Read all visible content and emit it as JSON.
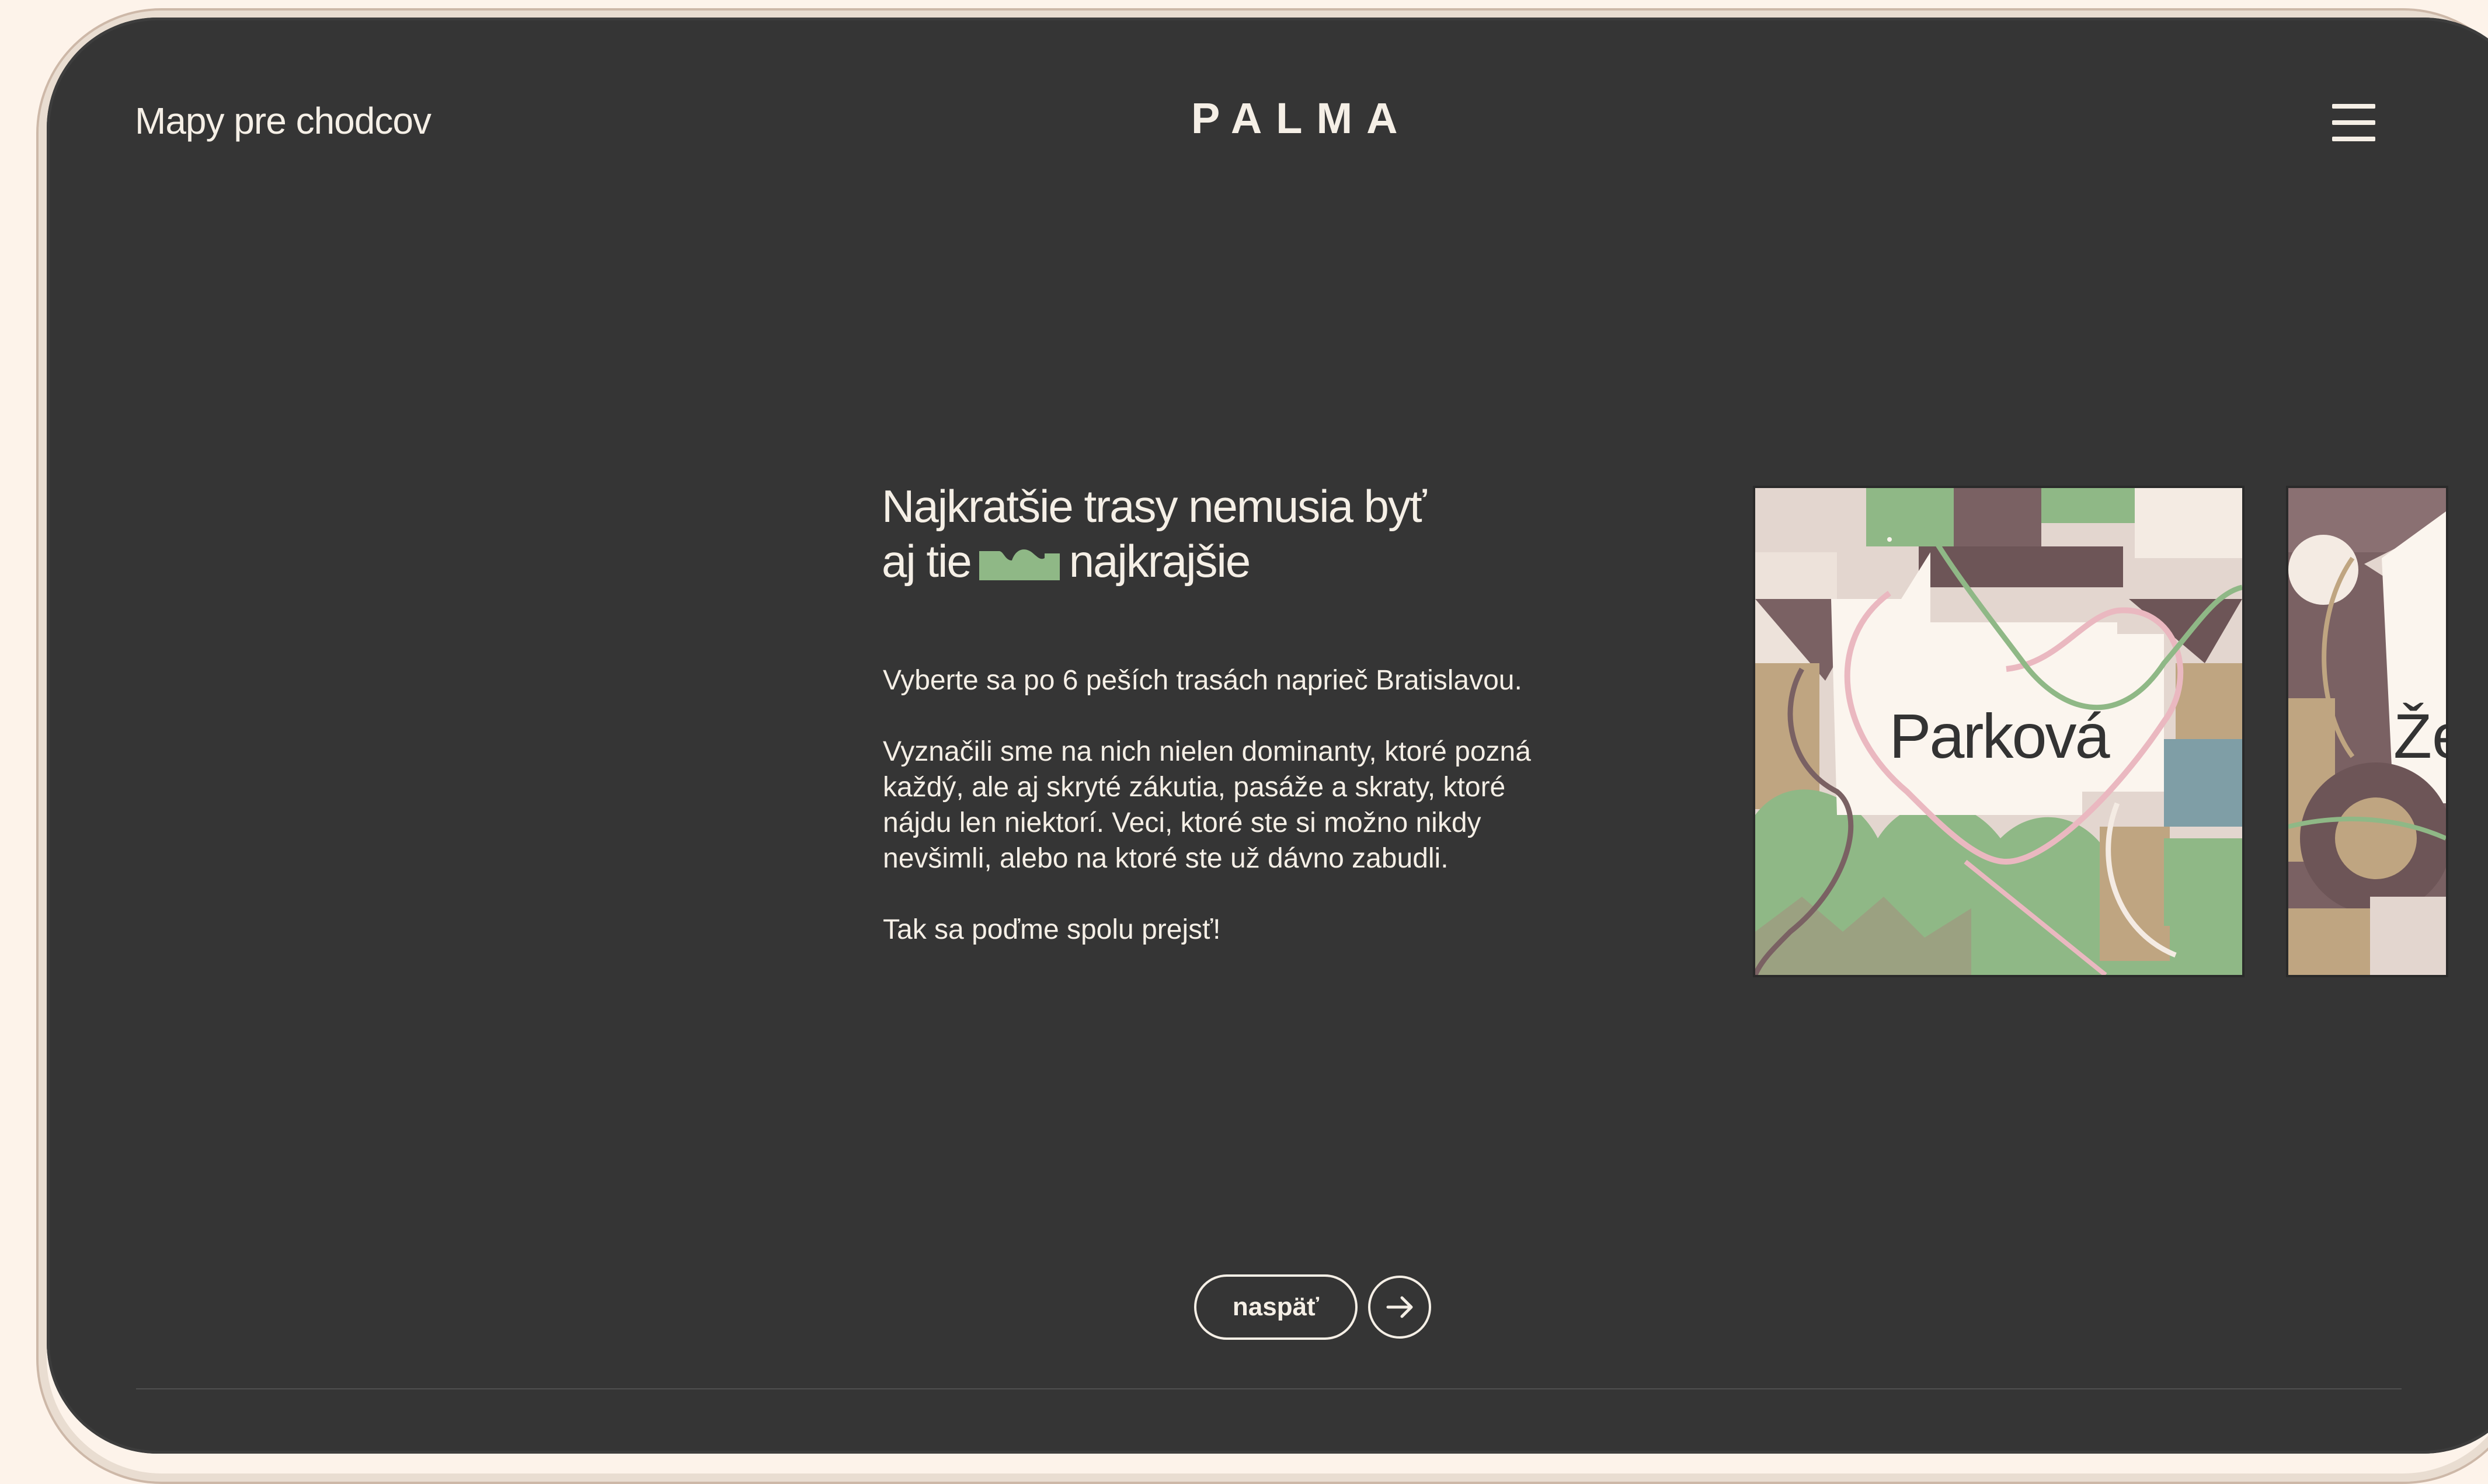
{
  "header": {
    "site_title": "Mapy pre chodcov",
    "logo": "PALMA",
    "menu_icon": "hamburger-menu-icon"
  },
  "intro": {
    "headline_line1": "Najkratšie trasy nemusia byť",
    "headline_line2_before": "aj tie",
    "headline_icon": "green-hills-icon",
    "headline_line2_after": "najkrajšie",
    "paragraph1": "Vyberte sa po 6 peších trasách naprieč Bratislavou.",
    "paragraph2": "Vyznačili sme na nich nielen dominanty, ktoré pozná každý, ale aj skryté zákutia, pasáže a skraty, ktoré nájdu len niektorí. Veci, ktoré ste si možno nikdy nevšimli, alebo na ktoré ste už dávno zabudli.",
    "paragraph3": "Tak sa poďme spolu prejsť!"
  },
  "cards": [
    {
      "title": "Parková"
    },
    {
      "title": "Že"
    }
  ],
  "controls": {
    "back_label": "naspäť",
    "next_icon": "arrow-right-icon"
  },
  "colors": {
    "background": "#353535",
    "frame": "#fdf3ea",
    "text": "#f5efe6",
    "accent_green": "#8fb886",
    "accent_pink": "#eab8c0",
    "accent_brown": "#7a6163",
    "accent_tan": "#bfa581",
    "accent_blue": "#7f9ea6"
  }
}
